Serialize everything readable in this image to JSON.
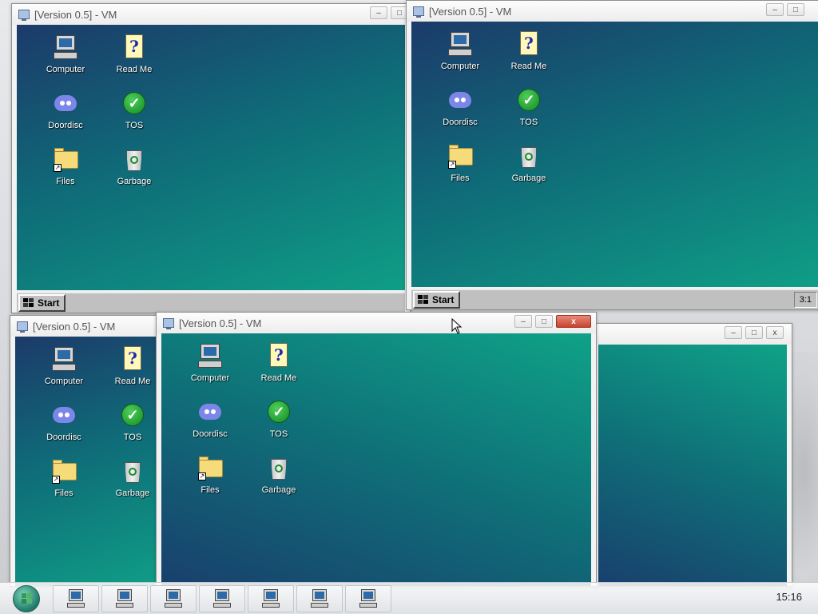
{
  "vm_windows": [
    {
      "title": "[Version 0.5] - VM",
      "start_label": "Start",
      "clock": ""
    },
    {
      "title": "[Version 0.5] - VM",
      "start_label": "Start",
      "clock": "3:1"
    },
    {
      "title": "[Version 0.5] - VM",
      "start_label": "",
      "clock": ""
    },
    {
      "title": "[Version 0.5] - VM",
      "start_label": "",
      "clock": ""
    },
    {
      "title": "",
      "start_label": "",
      "clock": ""
    }
  ],
  "desktop_icons": [
    {
      "label": "Computer",
      "icon": "computer-icon"
    },
    {
      "label": "Read Me",
      "icon": "readme-icon"
    },
    {
      "label": "Doordisc",
      "icon": "doordisc-icon"
    },
    {
      "label": "TOS",
      "icon": "tos-icon"
    },
    {
      "label": "Files",
      "icon": "folder-icon"
    },
    {
      "label": "Garbage",
      "icon": "recycle-bin-icon"
    }
  ],
  "window_controls": {
    "minimize": "–",
    "maximize": "□",
    "close": "x"
  },
  "host_taskbar": {
    "clock": "15:16",
    "app_count_label": "7"
  }
}
